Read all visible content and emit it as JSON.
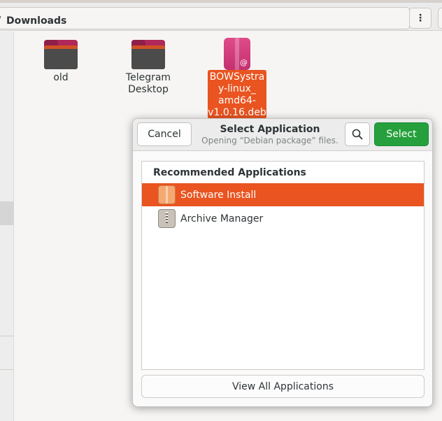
{
  "window": {
    "location_title": "Downloads",
    "path_arrow": "/",
    "menu_icon": "⋮"
  },
  "files": [
    {
      "name": "old",
      "type": "folder"
    },
    {
      "name_line1": "Telegram",
      "name_line2": "Desktop",
      "type": "folder"
    },
    {
      "name_lines": [
        "BOWSystra",
        "y-linux_",
        "amd64-",
        "v1.0.16.deb"
      ],
      "type": "deb-package",
      "selected": true
    }
  ],
  "dialog": {
    "title": "Select Application",
    "subtitle": "Opening “Debian package” files.",
    "cancel_label": "Cancel",
    "select_label": "Select",
    "search_icon": "search-icon",
    "section_heading": "Recommended Applications",
    "apps": [
      {
        "name": "Software Install",
        "icon": "software-install-icon",
        "selected": true
      },
      {
        "name": "Archive Manager",
        "icon": "archive-manager-icon",
        "selected": false
      }
    ],
    "view_all_label": "View All Applications"
  },
  "colors": {
    "accent": "#e95420",
    "select_button": "#26a03c"
  }
}
